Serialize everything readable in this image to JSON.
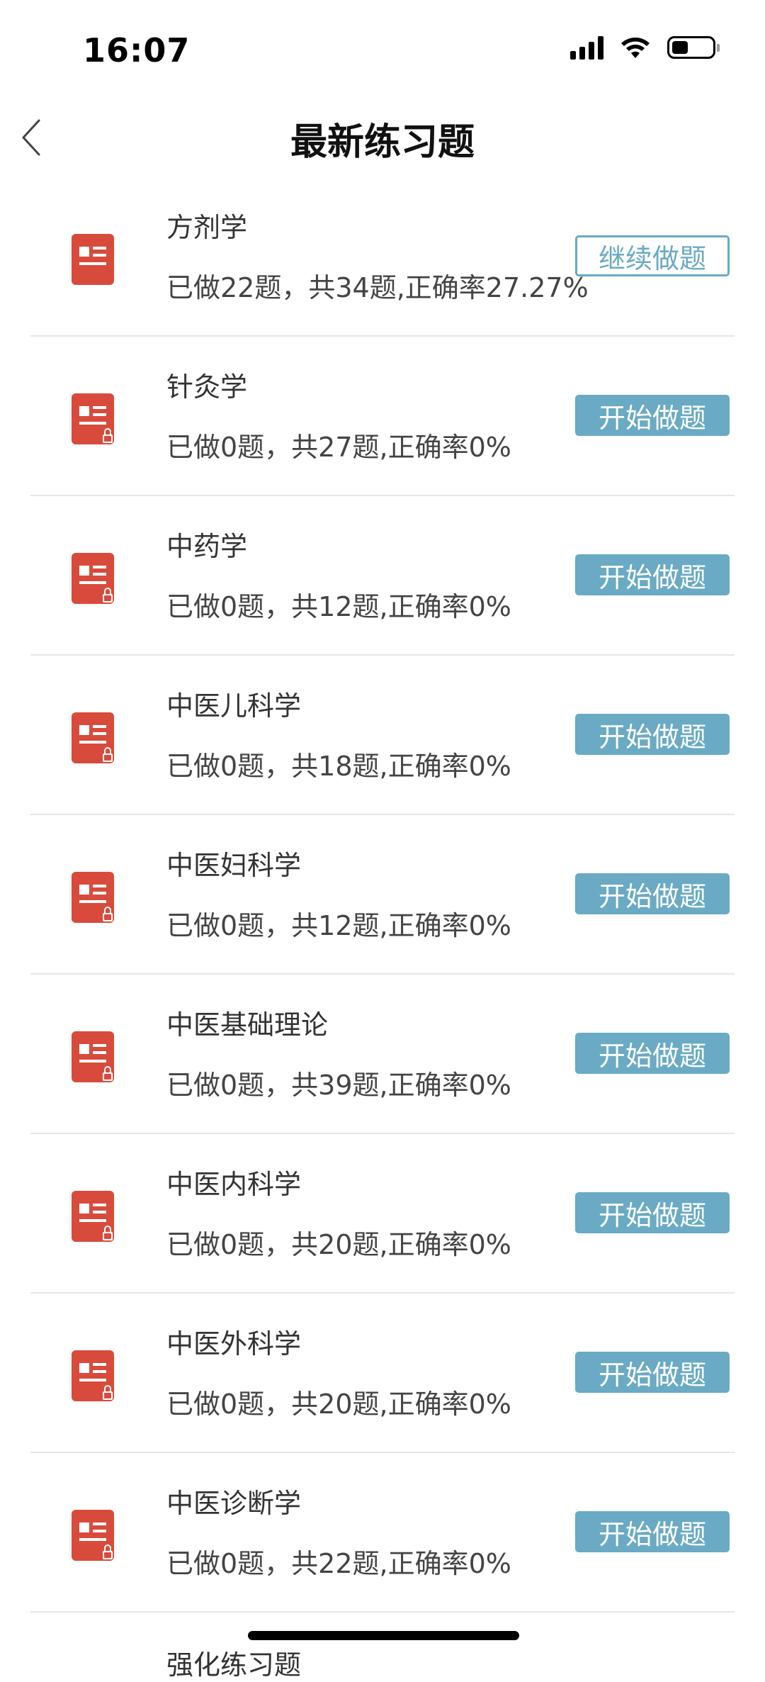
{
  "status_bar": {
    "time": "16:07",
    "battery_level": 0.4,
    "icons": [
      "cellular-signal-icon",
      "wifi-icon",
      "battery-icon"
    ]
  },
  "nav": {
    "back_icon": "chevron-left-icon",
    "title": "最新练习题"
  },
  "colors": {
    "accent": "#6aaac4",
    "item_icon": "#d84b3c",
    "divider": "#e6e6e6"
  },
  "items": [
    {
      "title": "方剂学",
      "stats": "已做22题，共34题,正确率27.27%",
      "button": "继续做题",
      "locked": false,
      "style": "continue"
    },
    {
      "title": "针灸学",
      "stats": "已做0题，共27题,正确率0%",
      "button": "开始做题",
      "locked": true,
      "style": "start"
    },
    {
      "title": "中药学",
      "stats": "已做0题，共12题,正确率0%",
      "button": "开始做题",
      "locked": true,
      "style": "start"
    },
    {
      "title": "中医儿科学",
      "stats": "已做0题，共18题,正确率0%",
      "button": "开始做题",
      "locked": true,
      "style": "start"
    },
    {
      "title": "中医妇科学",
      "stats": "已做0题，共12题,正确率0%",
      "button": "开始做题",
      "locked": true,
      "style": "start"
    },
    {
      "title": "中医基础理论",
      "stats": "已做0题，共39题,正确率0%",
      "button": "开始做题",
      "locked": true,
      "style": "start"
    },
    {
      "title": "中医内科学",
      "stats": "已做0题，共20题,正确率0%",
      "button": "开始做题",
      "locked": true,
      "style": "start"
    },
    {
      "title": "中医外科学",
      "stats": "已做0题，共20题,正确率0%",
      "button": "开始做题",
      "locked": true,
      "style": "start"
    },
    {
      "title": "中医诊断学",
      "stats": "已做0题，共22题,正确率0%",
      "button": "开始做题",
      "locked": true,
      "style": "start"
    }
  ],
  "peek_item": {
    "title": "强化练习题"
  }
}
